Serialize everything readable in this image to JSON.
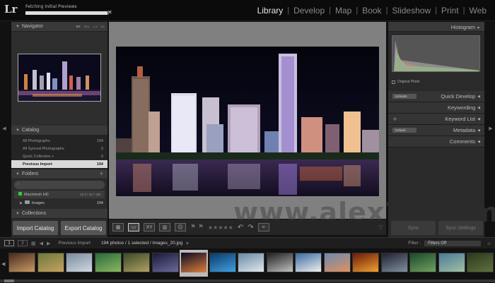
{
  "app": {
    "logo": "Lr"
  },
  "progress": {
    "title": "Fetching Initial Previews",
    "fraction": 0.98
  },
  "modules": [
    {
      "label": "Library",
      "active": true
    },
    {
      "label": "Develop",
      "active": false
    },
    {
      "label": "Map",
      "active": false
    },
    {
      "label": "Book",
      "active": false
    },
    {
      "label": "Slideshow",
      "active": false
    },
    {
      "label": "Print",
      "active": false
    },
    {
      "label": "Web",
      "active": false
    }
  ],
  "navigator": {
    "title": "Navigator",
    "zoom": [
      "FIT",
      "FILL",
      "1:1",
      "3:1"
    ]
  },
  "catalog": {
    "title": "Catalog",
    "items": [
      {
        "label": "All Photographs",
        "count": "194"
      },
      {
        "label": "All Synced Photographs",
        "count": "0"
      },
      {
        "label": "Quick Collection +",
        "count": "0"
      },
      {
        "label": "Previous Import",
        "count": "194"
      }
    ]
  },
  "folders": {
    "title": "Folders",
    "volume": {
      "name": "Macintosh HD",
      "capacity": "15.3 / 42.7 GB"
    },
    "folder": {
      "name": "Images",
      "count": "194"
    }
  },
  "collections": {
    "title": "Collections"
  },
  "left_buttons": {
    "import": "Import Catalog",
    "export": "Export Catalog"
  },
  "right_panel": {
    "histogram": "Histogram",
    "original_photo": "Original Photo",
    "quick_develop": "Quick Develop",
    "quick_develop_preset": "Defaults",
    "keywording": "Keywording",
    "keyword_list": "Keyword List",
    "metadata": "Metadata",
    "metadata_preset": "Default",
    "comments": "Comments",
    "sync": "Sync",
    "sync_settings": "Sync Settings"
  },
  "watermark": "www.alex71.com",
  "filmstrip_bar": {
    "page1": "1",
    "page2": "2",
    "source": "Previous Import",
    "info": "194 photos / 1 selected / Images_20.jpg",
    "filter_label": "Filter :",
    "filter_value": "Filters Off"
  },
  "colors": {
    "active_module": "#e6e6e6",
    "panel_bg": "#2b2b2b",
    "center_bg": "#808080",
    "volume_indicator": "#33cc33"
  },
  "thumbnails": [
    {
      "colors": [
        "#4a2a20",
        "#c89a60"
      ]
    },
    {
      "colors": [
        "#6a7a3a",
        "#c8a060"
      ]
    },
    {
      "colors": [
        "#7a8aa0",
        "#d0d8e0"
      ]
    },
    {
      "colors": [
        "#2a6a3a",
        "#8ab860"
      ]
    },
    {
      "colors": [
        "#3a4a2a",
        "#b0a060"
      ]
    },
    {
      "colors": [
        "#1a1a3a",
        "#6a6a9a"
      ]
    },
    {
      "colors": [
        "#0a0a20",
        "#e08040"
      ]
    },
    {
      "colors": [
        "#0a3a6a",
        "#40a0e0"
      ]
    },
    {
      "colors": [
        "#6a8aa0",
        "#e0e8f0"
      ]
    },
    {
      "colors": [
        "#202020",
        "#c0c0c0"
      ]
    },
    {
      "colors": [
        "#3a6aa0",
        "#f0f0f0"
      ]
    },
    {
      "colors": [
        "#6a8ab0",
        "#e09060"
      ]
    },
    {
      "colors": [
        "#6a1a0a",
        "#f0a030"
      ]
    },
    {
      "colors": [
        "#202030",
        "#8090a0"
      ]
    },
    {
      "colors": [
        "#1a4a2a",
        "#70a060"
      ]
    },
    {
      "colors": [
        "#4a7a9a",
        "#a0c0a0"
      ]
    },
    {
      "colors": [
        "#2a3a1a",
        "#607040"
      ]
    }
  ]
}
